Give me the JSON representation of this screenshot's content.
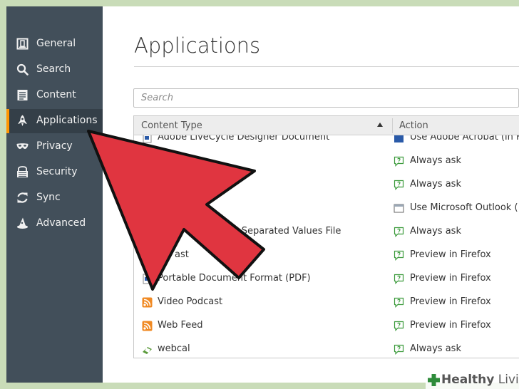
{
  "colors": {
    "sidebar_bg": "#424f5a",
    "sidebar_active_bg": "#343f48",
    "accent": "#ff9500",
    "arrow_red": "#e03540",
    "page_bg": "#c9dcb8"
  },
  "sidebar": {
    "items": [
      {
        "label": "General",
        "icon": "general-icon"
      },
      {
        "label": "Search",
        "icon": "search-icon"
      },
      {
        "label": "Content",
        "icon": "document-icon"
      },
      {
        "label": "Applications",
        "icon": "rocket-icon",
        "active": true
      },
      {
        "label": "Privacy",
        "icon": "mask-icon"
      },
      {
        "label": "Security",
        "icon": "security-icon"
      },
      {
        "label": "Sync",
        "icon": "sync-icon"
      },
      {
        "label": "Advanced",
        "icon": "wizard-hat-icon"
      }
    ]
  },
  "main": {
    "title": "Applications",
    "search": {
      "placeholder": "Search",
      "value": ""
    },
    "table": {
      "columns": {
        "content_type": "Content Type",
        "action": "Action"
      },
      "rows": [
        {
          "content_type": "Adobe LiveCycle Designer Document",
          "action": "Use Adobe Acrobat (in F",
          "ct_icon": "pdf-doc-icon",
          "ac_icon": "acrobat-icon"
        },
        {
          "content_type": "",
          "action": "Always ask",
          "ct_icon": "",
          "ac_icon": "ask-icon"
        },
        {
          "content_type": "",
          "action": "Always ask",
          "ct_icon": "",
          "ac_icon": "ask-icon"
        },
        {
          "content_type": "",
          "action": "Use Microsoft Outlook (",
          "ct_icon": "",
          "ac_icon": "outlook-icon"
        },
        {
          "content_type": "ma Separated Values File",
          "action": "Always ask",
          "ct_icon": "",
          "ac_icon": "ask-icon"
        },
        {
          "content_type": "ast",
          "action": "Preview in Firefox",
          "ct_icon": "feed-icon",
          "ac_icon": "ask-icon"
        },
        {
          "content_type": "Portable Document Format (PDF)",
          "action": "Preview in Firefox",
          "ct_icon": "pdf-doc-icon",
          "ac_icon": "ask-icon"
        },
        {
          "content_type": "Video Podcast",
          "action": "Preview in Firefox",
          "ct_icon": "feed-icon",
          "ac_icon": "ask-icon"
        },
        {
          "content_type": "Web Feed",
          "action": "Preview in Firefox",
          "ct_icon": "feed-icon",
          "ac_icon": "ask-icon"
        },
        {
          "content_type": "webcal",
          "action": "Always ask",
          "ct_icon": "webcal-icon",
          "ac_icon": "ask-icon"
        }
      ]
    }
  },
  "watermark": {
    "brand_bold": "Healthy",
    "brand_rest": " Living"
  }
}
